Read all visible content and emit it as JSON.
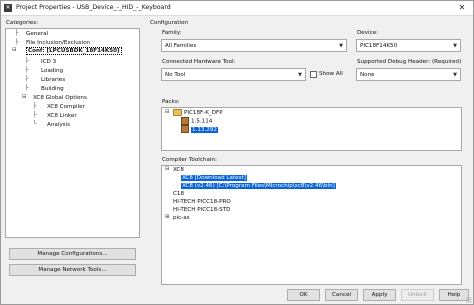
{
  "window": {
    "title": "Project Properties - USB_Device_-_HID_-_Keyboard"
  },
  "left": {
    "categories_label": "Categories:",
    "tree": [
      "General",
      "File Inclusion/Exclusion",
      "Conf: [LPCUSBDK_18F14K50]",
      "ICD 3",
      "Loading",
      "Libraries",
      "Building",
      "XC8 Global Options",
      "XC8 Compiler",
      "XC8 Linker",
      "Analysis"
    ],
    "manage_configurations": "Manage Configurations...",
    "manage_network_tools": "Manage Network Tools..."
  },
  "config": {
    "section_label": "Configuration",
    "family_label": "Family:",
    "family_value": "All Families",
    "device_label": "Device:",
    "device_value": "PIC18F14K50",
    "connected_hw_label": "Connected Hardware Tool:",
    "connected_hw_value": "No Tool",
    "show_all_label": "Show All",
    "debug_header_label": "Supported Debug Header:",
    "debug_header_required": "(Required)",
    "debug_header_value": "None"
  },
  "packs": {
    "label": "Packs:",
    "root": "PIC18F-K_DFP",
    "versions": [
      "1.5.114",
      "1.13.292"
    ]
  },
  "toolchain": {
    "label": "Compiler Toolchain:",
    "items": [
      "XC8",
      "XC8 [Download Latest]",
      "XC8 (v2.46) [C:\\Program Files\\Microchip\\xc8\\v2.46\\bin]",
      "C18",
      "HI-TECH PICC18-PRO",
      "HI-TECH PICC18-STD",
      "pic-as"
    ]
  },
  "buttons": {
    "ok": "OK",
    "cancel": "Cancel",
    "apply": "Apply",
    "unlock": "Unlock",
    "help": "Help"
  },
  "icons": {
    "expand": "⊞",
    "collapse": "⊟"
  }
}
